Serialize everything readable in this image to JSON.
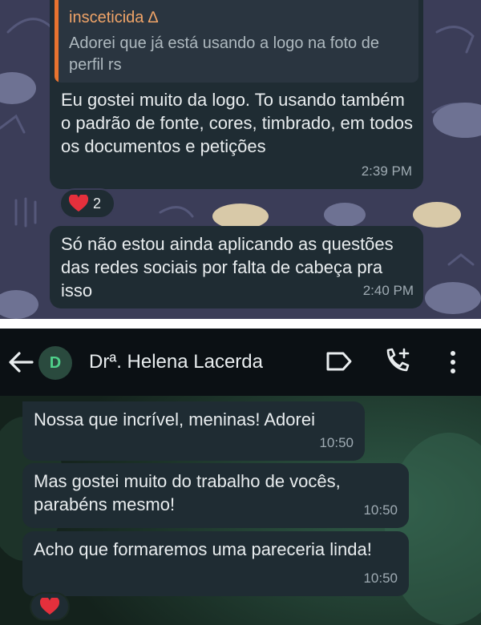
{
  "top_chat": {
    "message1": {
      "quote_author": "insceticida ∆",
      "quote_text": "Adorei que já está usando a logo na foto de perfil rs",
      "text": "Eu gostei muito da logo. To usando também o padrão de fonte, cores, timbrado, em todos os documentos e petições",
      "time": "2:39 PM",
      "reaction_emoji": "heart-icon",
      "reaction_count": "2"
    },
    "message2": {
      "text": "Só não estou ainda aplicando as questões das redes sociais por falta de cabeça pra isso",
      "time": "2:40 PM"
    }
  },
  "bottom_chat": {
    "header": {
      "avatar_letter": "D",
      "contact_name": "Drª. Helena Lacerda",
      "icons": [
        "back-arrow-icon",
        "label-icon",
        "add-call-icon",
        "more-options-icon"
      ]
    },
    "messages": [
      {
        "text": "Nossa que incrível, meninas! Adorei",
        "time": "10:50"
      },
      {
        "text": "Mas gostei muito do trabalho de vocês, parabéns mesmo!",
        "time": "10:50"
      },
      {
        "text": "Acho que formaremos uma pareceria linda!",
        "time": "10:50"
      }
    ],
    "reaction_emoji": "heart-icon"
  },
  "colors": {
    "top_wallpaper": "#3b3d58",
    "bubble": "#1f2c33",
    "quote_accent": "#e8732f",
    "reaction_heart": "#e5303c",
    "header_bg": "#0b1014",
    "avatar_text": "#4fd08a"
  }
}
